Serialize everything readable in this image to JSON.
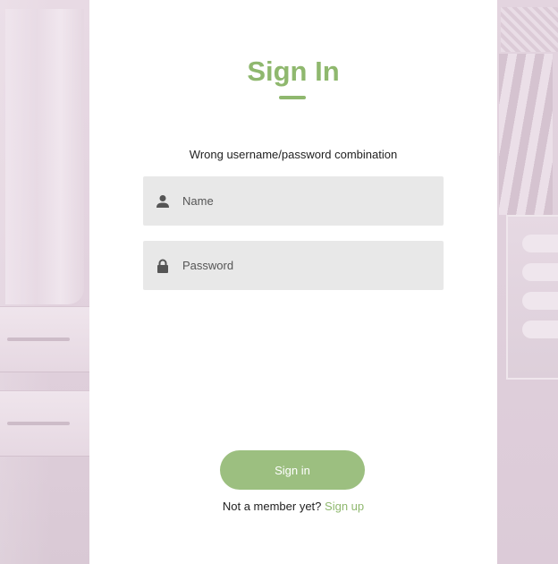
{
  "signin": {
    "title": "Sign In",
    "error_message": "Wrong username/password combination",
    "name_field": {
      "placeholder": "Name",
      "value": "",
      "icon": "user-icon"
    },
    "password_field": {
      "placeholder": "Password",
      "value": "",
      "icon": "lock-icon"
    },
    "submit_label": "Sign in",
    "member_prompt": "Not a member yet?",
    "signup_link": "Sign up"
  },
  "colors": {
    "accent": "#8fb86e",
    "button": "#9cbf80",
    "field_bg": "#e8e8e8",
    "background": "#eadbe6"
  }
}
